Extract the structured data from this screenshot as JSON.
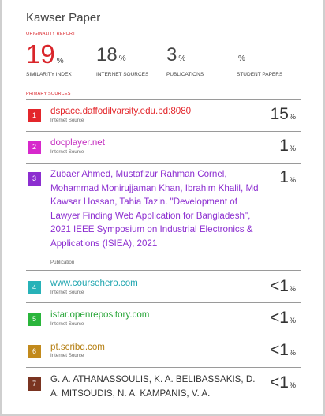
{
  "document": {
    "title": "Kawser Paper"
  },
  "report": {
    "section_label": "ORIGINALITY REPORT",
    "primary_sources_label": "PRIMARY SOURCES",
    "scores": [
      {
        "value": "19",
        "unit": "%",
        "label": "SIMILARITY INDEX"
      },
      {
        "value": "18",
        "unit": "%",
        "label": "INTERNET SOURCES"
      },
      {
        "value": "3",
        "unit": "%",
        "label": "PUBLICATIONS"
      },
      {
        "value": "",
        "unit": "%",
        "label": "STUDENT PAPERS"
      }
    ]
  },
  "sources": [
    {
      "rank": "1",
      "title": "dspace.daffodilvarsity.edu.bd:8080",
      "type": "Internet Source",
      "match": "15",
      "unit": "%",
      "badge_color": "#e3262b",
      "title_color": "#e3262b"
    },
    {
      "rank": "2",
      "title": "docplayer.net",
      "type": "Internet Source",
      "match": "1",
      "unit": "%",
      "badge_color": "#d728cc",
      "title_color": "#c42dc0"
    },
    {
      "rank": "3",
      "title": "Zubaer Ahmed, Mustafizur Rahman Cornel, Mohammad Monirujjaman Khan, Ibrahim Khalil, Md Kawsar Hossan, Tahia Tazin. \"Development of Lawyer Finding Web Application for Bangladesh\", 2021 IEEE Symposium on Industrial Electronics & Applications (ISIEA), 2021",
      "type": "Publication",
      "match": "1",
      "unit": "%",
      "badge_color": "#8c2ed0",
      "title_color": "#8c2ed0"
    },
    {
      "rank": "4",
      "title": "www.coursehero.com",
      "type": "Internet Source",
      "match": "<1",
      "unit": "%",
      "badge_color": "#27b2b8",
      "title_color": "#20a6b0"
    },
    {
      "rank": "5",
      "title": "istar.openrepository.com",
      "type": "Internet Source",
      "match": "<1",
      "unit": "%",
      "badge_color": "#2ab53b",
      "title_color": "#2aa63a"
    },
    {
      "rank": "6",
      "title": "pt.scribd.com",
      "type": "Internet Source",
      "match": "<1",
      "unit": "%",
      "badge_color": "#c28a1c",
      "title_color": "#b57f12"
    },
    {
      "rank": "7",
      "title": "G. A. ATHANASSOULIS, K. A. BELIBASSAKIS, D. A. MITSOUDIS, N. A. KAMPANIS, V. A.",
      "type": "",
      "match": "<1",
      "unit": "%",
      "badge_color": "#7a3421",
      "title_color": "#333333"
    }
  ]
}
